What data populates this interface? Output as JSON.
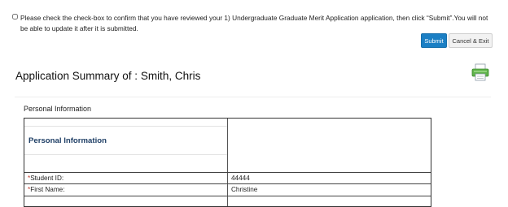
{
  "confirm": {
    "text": "Please check the check-box to confirm that you have reviewed your 1) Undergraduate Graduate Merit Application application, then click “Submit”.You will not be able to update it after it is submitted."
  },
  "buttons": {
    "submit": "Submit",
    "cancel": "Cancel & Exit"
  },
  "summary": {
    "title": "Application Summary of : Smith, Chris",
    "print_icon": "printer-icon"
  },
  "section": {
    "label": "Personal Information",
    "table_heading": "Personal Information",
    "rows": [
      {
        "required": "*",
        "label": "Student ID:",
        "value": "44444"
      },
      {
        "required": "*",
        "label": "First Name:",
        "value": "Christine"
      }
    ]
  },
  "colors": {
    "accent": "#1b7fc4",
    "heading": "#1f3f66",
    "required": "#c0392b"
  }
}
